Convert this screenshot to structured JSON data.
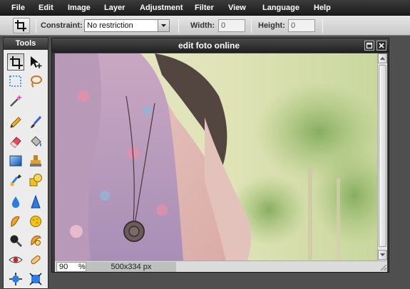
{
  "menu": {
    "items": [
      "File",
      "Edit",
      "Image",
      "Layer",
      "Adjustment",
      "Filter",
      "View",
      "Language",
      "Help"
    ]
  },
  "toolbar": {
    "active_tool_icon": "crop-icon",
    "constraint_label": "Constraint:",
    "constraint_value": "No restriction",
    "width_label": "Width:",
    "width_value": "0",
    "height_label": "Height:",
    "height_value": "0"
  },
  "tools_panel": {
    "title": "Tools",
    "tools": [
      "crop-icon",
      "move-icon",
      "marquee-select-icon",
      "lasso-icon",
      "magic-wand-icon",
      "",
      "pencil-icon",
      "brush-icon",
      "eraser-icon",
      "paint-bucket-icon",
      "gradient-icon",
      "clone-stamp-icon",
      "color-replace-icon",
      "drawing-shapes-icon",
      "blur-icon",
      "sharpen-icon",
      "smudge-icon",
      "sponge-icon",
      "dodge-icon",
      "burn-icon",
      "red-eye-icon",
      "spot-heal-icon",
      "bloat-icon",
      "pinch-icon"
    ]
  },
  "document": {
    "title": "edit foto online",
    "zoom_value": "90",
    "zoom_unit": "%",
    "image_size": "500x334 px"
  },
  "colors": {
    "menubar_bg": "#1d1d1d",
    "workspace_bg": "#4f4f4f",
    "panel_bg": "#ececec",
    "accent_blue": "#2b7de0"
  }
}
